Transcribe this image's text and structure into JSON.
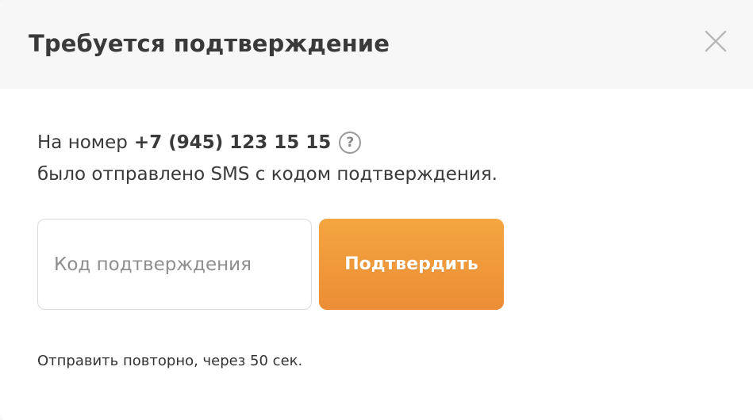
{
  "dialog": {
    "title": "Требуется подтверждение",
    "close_icon": "close-icon"
  },
  "message": {
    "prefix": "На номер",
    "phone": "+7 (945) 123 15 15",
    "help_icon": "question-circle-icon",
    "help_glyph": "?",
    "line2": "было отправлено SMS с кодом подтверждения."
  },
  "form": {
    "code_value": "",
    "code_placeholder": "Код подтверждения",
    "confirm_label": "Подтвердить"
  },
  "resend": {
    "text": "Отправить повторно, через 50 сек."
  },
  "colors": {
    "accent_top": "#f4a640",
    "accent_bottom": "#ec8d35",
    "header_bg": "#f7f7f7",
    "text": "#3a3a3a"
  }
}
